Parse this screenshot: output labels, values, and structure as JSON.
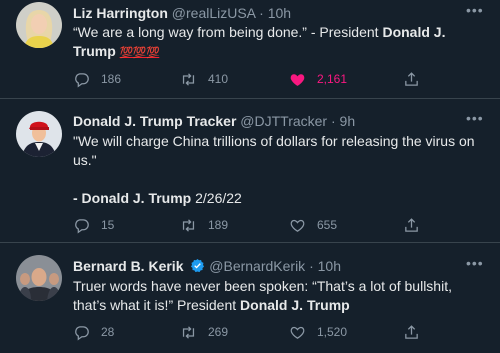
{
  "colors": {
    "background": "#15202b",
    "text": "#e7e9ea",
    "muted": "#8b98a5",
    "like": "#f91880",
    "verified": "#1d9bf0",
    "divider": "#38444d"
  },
  "tweets": [
    {
      "name": "Liz Harrington",
      "handle": "@realLizUSA",
      "dot": "·",
      "time": "10h",
      "text_part1": "“We are a long way from being done.” - President ",
      "text_bold": "Donald J. Trump",
      "emoji": "💯💯💯",
      "replies": "186",
      "retweets": "410",
      "likes": "2,161",
      "liked": true
    },
    {
      "name": "Donald J. Trump Tracker",
      "handle": "@DJTTracker",
      "dot": "·",
      "time": "9h",
      "text_quote": "\"We will charge China trillions of dollars for releasing the virus on us.\"",
      "text_attr_prefix": "- Donald J. Trump",
      "text_attr_date": "2/26/22",
      "replies": "15",
      "retweets": "189",
      "likes": "655",
      "liked": false
    },
    {
      "name": "Bernard B. Kerik",
      "handle": "@BernardKerik",
      "dot": "·",
      "time": "10h",
      "verified": true,
      "text_part1": "Truer words have never been spoken: “That’s a lot of bullshit, that’s what it is!” President ",
      "text_bold": "Donald J. Trump",
      "replies": "28",
      "retweets": "269",
      "likes": "1,520",
      "liked": false
    }
  ]
}
